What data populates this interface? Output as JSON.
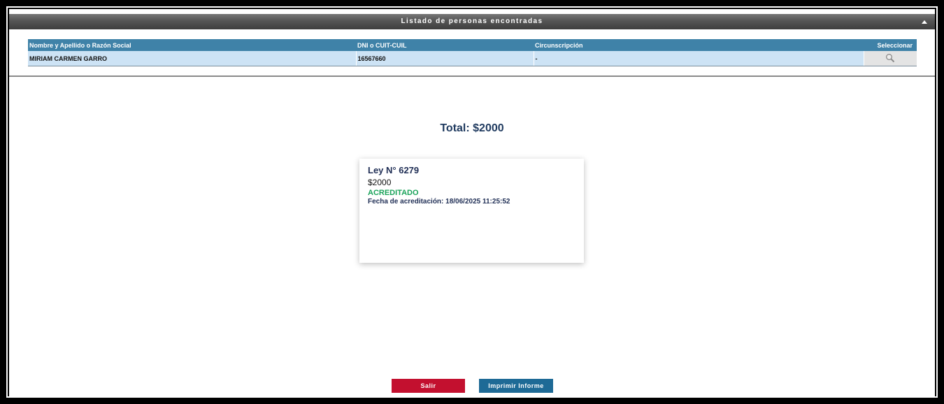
{
  "panel": {
    "title": "Listado de personas encontradas",
    "collapse_icon": "triangle-up-icon"
  },
  "table": {
    "headers": [
      "Nombre y Apellido o Razón Social",
      "DNI o CUIT-CUIL",
      "Circunscripción",
      "Seleccionar"
    ],
    "rows": [
      {
        "name": "MIRIAM CARMEN GARRO",
        "dni": "16567660",
        "circ": "-",
        "select_icon": "magnifier-icon"
      }
    ]
  },
  "summary": {
    "total": "Total: $2000"
  },
  "card": {
    "law": "Ley N° 6279",
    "amount": "$2000",
    "status": "ACREDITADO",
    "status_color": "#1aa35a",
    "date": "Fecha de acreditación: 18/06/2025 11:25:52"
  },
  "actions": {
    "exit_label": "Salir",
    "print_label": "Imprimir Informe",
    "exit_color": "#c3102f",
    "print_color": "#1e6a96"
  }
}
